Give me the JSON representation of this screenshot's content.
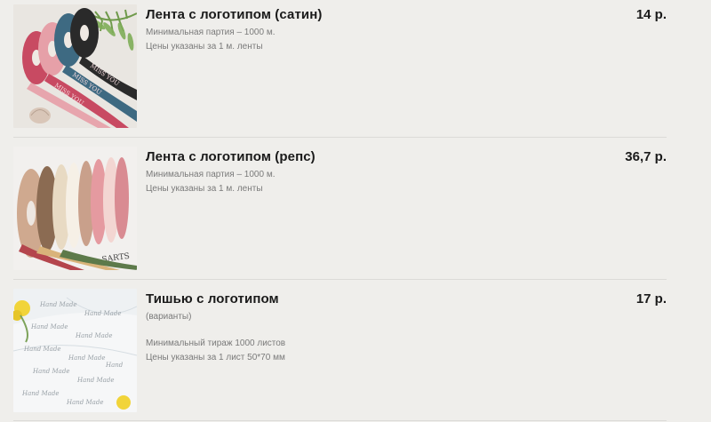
{
  "products": [
    {
      "title": "Лента с логотипом (сатин)",
      "price": "14 р.",
      "image_icon": "satin-ribbon-photo",
      "notes": [
        "Минимальная партия – 1000 м.",
        "Цены указаны за 1 м. ленты"
      ]
    },
    {
      "title": "Лента с логотипом (репс)",
      "price": "36,7 р.",
      "image_icon": "grosgrain-ribbon-photo",
      "notes": [
        "Минимальная партия – 1000 м.",
        "Цены указаны за 1 м. ленты"
      ]
    },
    {
      "title": "Тишью с логотипом",
      "price": "17 р.",
      "image_icon": "tissue-paper-photo",
      "subtitle": "(варианты)",
      "notes": [
        "Минимальный тираж 1000 листов",
        "Цены указаны за 1 лист 50*70 мм"
      ]
    }
  ],
  "ribbon_print_text": "MISS YOU"
}
